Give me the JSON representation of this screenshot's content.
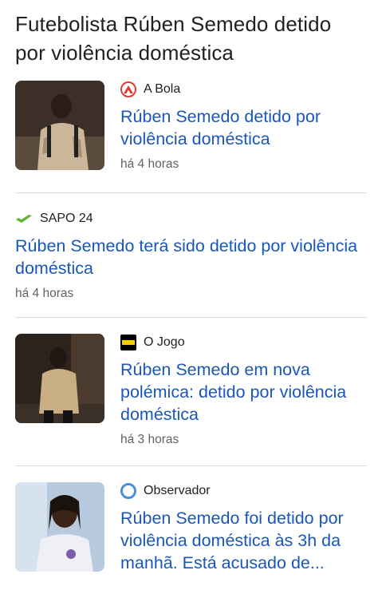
{
  "page": {
    "title": "Futebolista Rúben Semedo detido por violência doméstica"
  },
  "articles": [
    {
      "source": "A Bola",
      "headline": "Rúben Semedo detido por violência doméstica",
      "time": "há 4 horas",
      "logo_icon": "abola-logo-icon",
      "logo_color": "#e53935",
      "has_thumbnail": true
    },
    {
      "source": "SAPO 24",
      "headline": "Rúben Semedo terá sido detido por violência doméstica",
      "time": "há 4 horas",
      "logo_icon": "sapo-logo-icon",
      "logo_color": "#5cb531",
      "has_thumbnail": false
    },
    {
      "source": "O Jogo",
      "headline": "Rúben Semedo em nova polémica: detido por violência doméstica",
      "time": "há 3 horas",
      "logo_icon": "ojogo-logo-icon",
      "logo_color": "#f5d000",
      "has_thumbnail": true
    },
    {
      "source": "Observador",
      "headline": "Rúben Semedo foi detido por violência doméstica às 3h da manhã. Está acusado de...",
      "time": "",
      "logo_icon": "observador-logo-icon",
      "logo_color": "#4a90d9",
      "has_thumbnail": true
    }
  ],
  "colors": {
    "headline": "#1a57b8",
    "source": "#202124",
    "time": "#5f6368",
    "divider": "#dadce0"
  }
}
